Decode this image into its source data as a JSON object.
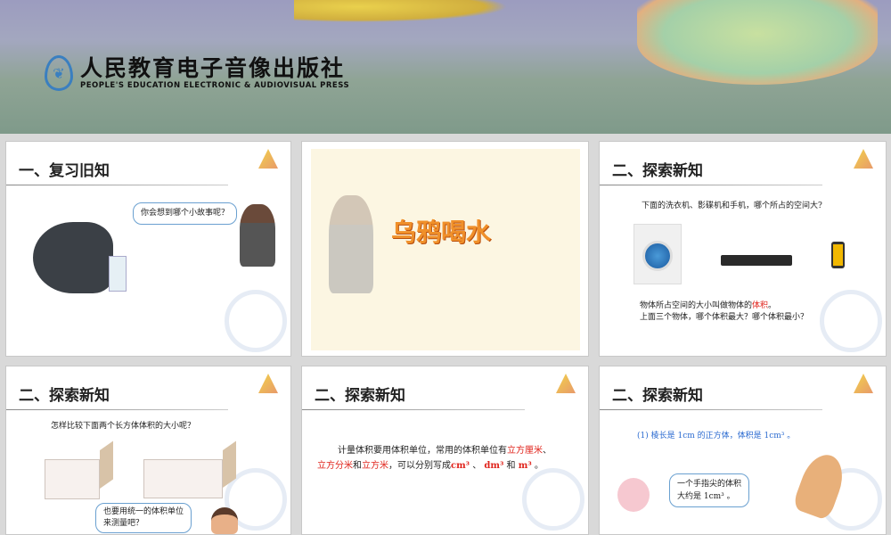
{
  "banner": {
    "publisher_cn": "人民教育电子音像出版社",
    "publisher_en": "PEOPLE'S EDUCATION ELECTRONIC & AUDIOVISUAL PRESS"
  },
  "slides": [
    {
      "title": "一、复习旧知",
      "bubble": "你会想到哪个小故事呢？"
    },
    {
      "title": "乌鸦喝水"
    },
    {
      "title": "二、探索新知",
      "question": "下面的洗衣机、影碟机和手机，哪个所占的空间大?",
      "def_pre": "物体所占空间的大小叫做物体的",
      "def_red": "体积",
      "def_post": "。",
      "q2": "上面三个物体，哪个体积最大？哪个体积最小？"
    },
    {
      "title": "二、探索新知",
      "question": "怎样比较下面两个长方体体积的大小呢？",
      "bubble_l1": "也要用统一的体积单位",
      "bubble_l2": "来测量吧？"
    },
    {
      "title": "二、探索新知",
      "p1": "计量体积要用体积单位，常用的体积单位有",
      "u1": "立方厘米",
      "sep1": "、",
      "u2": "立方分米",
      "and1": "和",
      "u3": "立方米",
      "p2": "，可以分别写成",
      "cm": "cm³",
      "sep2": " 、 ",
      "dm": "dm³",
      "and2": " 和 ",
      "m": "m³",
      "end": " 。"
    },
    {
      "title": "二、探索新知",
      "item": "(1) 棱长是 1cm 的正方体，体积是 1cm³ 。",
      "bubble_l1": "一个手指尖的体积",
      "bubble_l2": "大约是 1cm³ 。"
    }
  ]
}
